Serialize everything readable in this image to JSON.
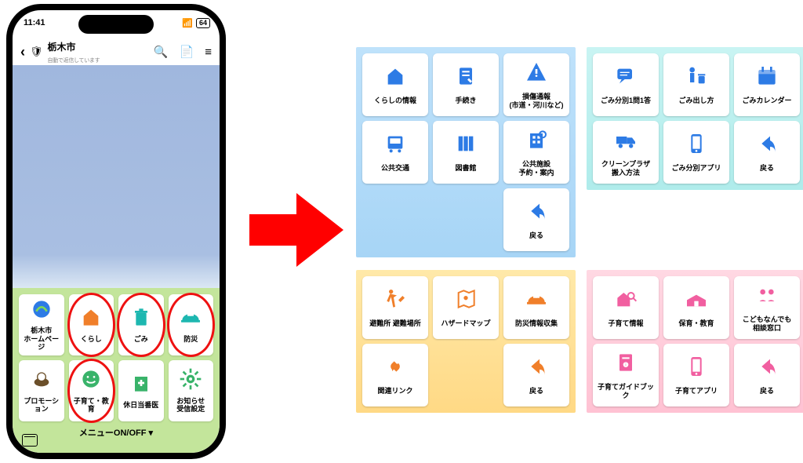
{
  "status": {
    "time": "11:41",
    "battery": "64"
  },
  "appbar": {
    "title": "栃木市",
    "subtitle": "自動で返信しています"
  },
  "phone_menu": {
    "items": [
      {
        "label": "栃木市\nホームページ",
        "icon": "logo",
        "color": "c-blue",
        "circled": false
      },
      {
        "label": "くらし",
        "icon": "house",
        "color": "c-orange",
        "circled": true
      },
      {
        "label": "ごみ",
        "icon": "trash",
        "color": "c-teal",
        "circled": true
      },
      {
        "label": "防災",
        "icon": "helmet",
        "color": "c-teal",
        "circled": true
      },
      {
        "label": "プロモーション",
        "icon": "promo",
        "color": "",
        "circled": false
      },
      {
        "label": "子育て・教育",
        "icon": "smile",
        "color": "c-green",
        "circled": true
      },
      {
        "label": "休日当番医",
        "icon": "hospital",
        "color": "c-green",
        "circled": false
      },
      {
        "label": "お知らせ\n受信設定",
        "icon": "gear",
        "color": "c-green",
        "circled": false
      }
    ],
    "toggle": "メニューON/OFF ▾"
  },
  "panels": [
    {
      "theme": "blue",
      "iconColor": "c-blue",
      "items": [
        {
          "label": "くらしの情報",
          "icon": "house"
        },
        {
          "label": "手続き",
          "icon": "form"
        },
        {
          "label": "損傷通報\n(市道・河川など)",
          "icon": "hazard"
        },
        {
          "label": "公共交通",
          "icon": "bus"
        },
        {
          "label": "図書館",
          "icon": "books"
        },
        {
          "label": "公共施設\n予約・案内",
          "icon": "building"
        },
        {
          "label": "戻る",
          "icon": "back"
        }
      ]
    },
    {
      "theme": "teal",
      "iconColor": "c-blue",
      "items": [
        {
          "label": "ごみ分別1問1答",
          "icon": "chat"
        },
        {
          "label": "ごみ出し方",
          "icon": "person-trash"
        },
        {
          "label": "ごみカレンダー",
          "icon": "calendar"
        },
        {
          "label": "クリーンプラザ\n搬入方法",
          "icon": "truck"
        },
        {
          "label": "ごみ分別アプリ",
          "icon": "phone"
        },
        {
          "label": "戻る",
          "icon": "back"
        }
      ]
    },
    {
      "theme": "yellow",
      "iconColor": "c-orange",
      "items": [
        {
          "label": "避難所 避難場所",
          "icon": "evac"
        },
        {
          "label": "ハザードマップ",
          "icon": "map"
        },
        {
          "label": "防災情報収集",
          "icon": "helmet"
        },
        {
          "label": "関連リンク",
          "icon": "link"
        },
        {
          "label": "戻る",
          "icon": "back"
        }
      ]
    },
    {
      "theme": "pink",
      "iconColor": "c-pink",
      "items": [
        {
          "label": "子育て情報",
          "icon": "house-search"
        },
        {
          "label": "保育・教育",
          "icon": "school"
        },
        {
          "label": "こどもなんでも\n相談窓口",
          "icon": "consult"
        },
        {
          "label": "子育てガイドブック",
          "icon": "book"
        },
        {
          "label": "子育てアプリ",
          "icon": "phone"
        },
        {
          "label": "戻る",
          "icon": "back"
        }
      ]
    }
  ]
}
